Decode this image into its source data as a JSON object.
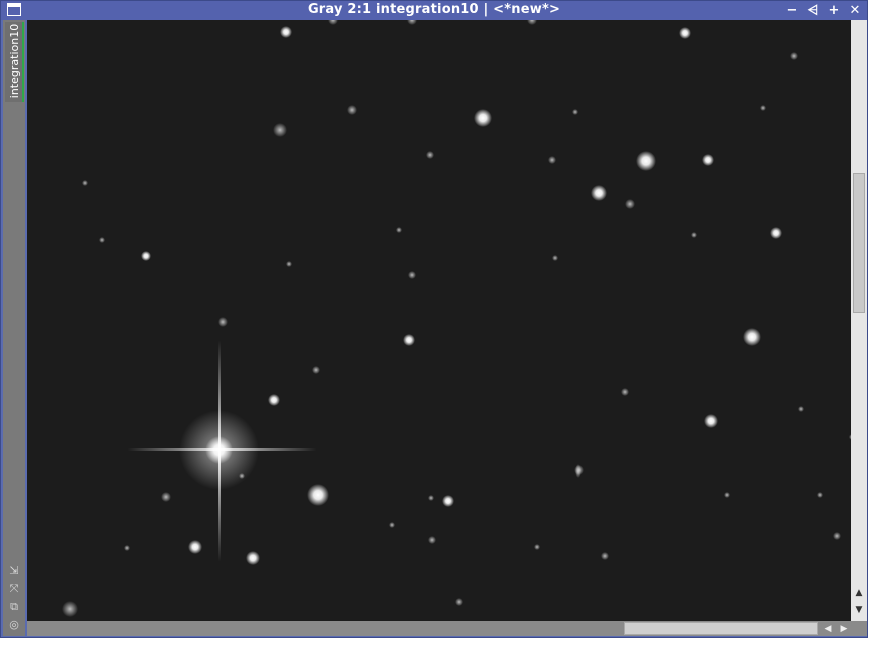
{
  "window": {
    "title": "Gray 2:1 integration10 | <*new*>",
    "controls": {
      "minimize": "−",
      "shade": "⩤",
      "maximize": "+",
      "close": "✕"
    }
  },
  "view_tab": {
    "label": "integration10"
  },
  "side_tools": [
    {
      "name": "fit-view-icon",
      "glyph": "⇲"
    },
    {
      "name": "zoom-to-fit-icon",
      "glyph": "⤧"
    },
    {
      "name": "clone-icon",
      "glyph": "⧉"
    },
    {
      "name": "target-icon",
      "glyph": "◎"
    }
  ],
  "scroll": {
    "up": "▲",
    "down": "▼",
    "left": "◀",
    "right": "▶"
  },
  "colors": {
    "titlebar": "#5462ae",
    "accent_tab": "#2ea84a",
    "sky": "#1c1c1c"
  }
}
